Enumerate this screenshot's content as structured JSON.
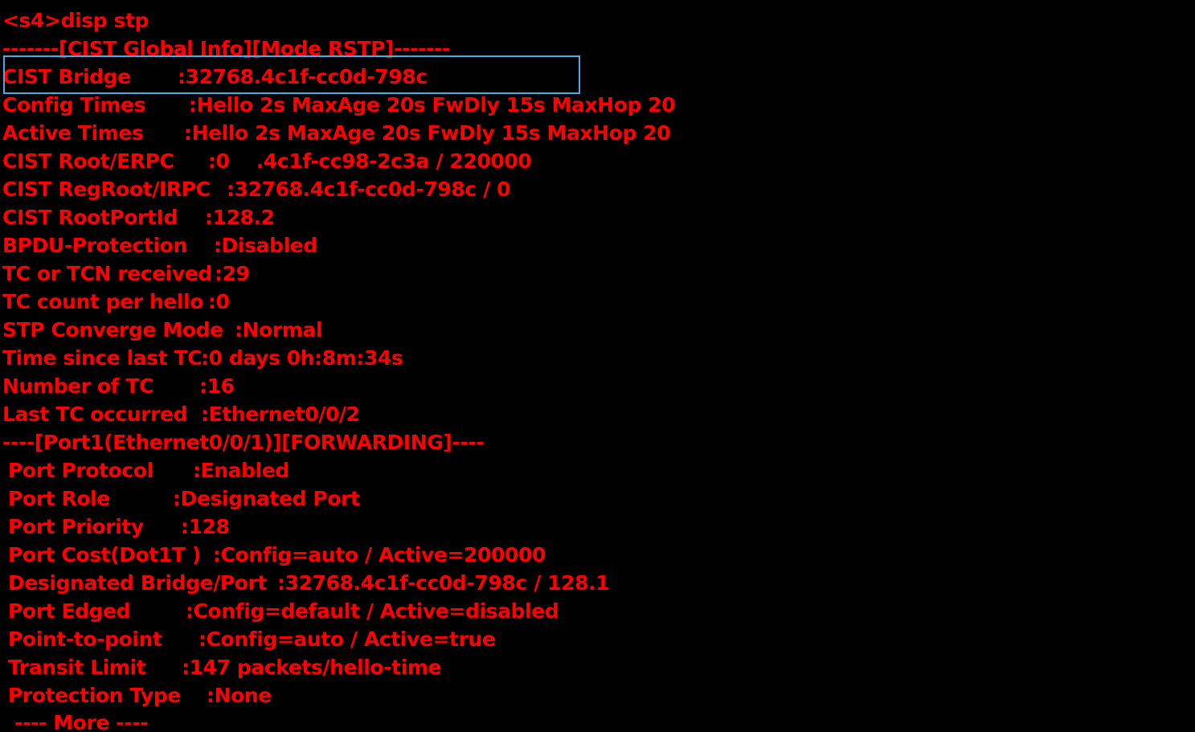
{
  "terminal": {
    "background": "#000000",
    "text_color": "#ff0000",
    "highlight_color": "#4fa8e6",
    "command_line": "<s4>disp stp",
    "global_header": "-------[CIST Global Info][Mode RSTP]-------",
    "global": [
      {
        "label": "CIST Bridge",
        "value": ":32768.4c1f-cc0d-798c"
      },
      {
        "label": "Config Times",
        "value": ":Hello 2s MaxAge 20s FwDly 15s MaxHop 20"
      },
      {
        "label": "Active Times",
        "value": ":Hello 2s MaxAge 20s FwDly 15s MaxHop 20"
      },
      {
        "label": "CIST Root/ERPC",
        "value": ":0    .4c1f-cc98-2c3a / 220000"
      },
      {
        "label": "CIST RegRoot/IRPC",
        "value": ":32768.4c1f-cc0d-798c / 0"
      },
      {
        "label": "CIST RootPortId",
        "value": ":128.2"
      },
      {
        "label": "BPDU-Protection",
        "value": ":Disabled"
      },
      {
        "label": "TC or TCN received",
        "value": ":29"
      },
      {
        "label": "TC count per hello",
        "value": ":0"
      },
      {
        "label": "STP Converge Mode",
        "value": ":Normal"
      },
      {
        "label": "Time since last TC",
        "value": ":0 days 0h:8m:34s"
      },
      {
        "label": "Number of TC",
        "value": ":16"
      },
      {
        "label": "Last TC occurred",
        "value": ":Ethernet0/0/2"
      }
    ],
    "port_header": "----[Port1(Ethernet0/0/1)][FORWARDING]----",
    "port": [
      {
        "label": "Port Protocol",
        "value": ":Enabled"
      },
      {
        "label": "Port Role",
        "value": ":Designated Port"
      },
      {
        "label": "Port Priority",
        "value": ":128"
      },
      {
        "label": "Port Cost(Dot1T )",
        "value": ":Config=auto / Active=200000"
      },
      {
        "label": "Designated Bridge/Port",
        "value": ":32768.4c1f-cc0d-798c / 128.1"
      },
      {
        "label": "Port Edged",
        "value": ":Config=default / Active=disabled"
      },
      {
        "label": "Point-to-point",
        "value": ":Config=auto / Active=true"
      },
      {
        "label": "Transit Limit",
        "value": ":147 packets/hello-time"
      },
      {
        "label": "Protection Type",
        "value": ":None"
      }
    ],
    "more_prompt": "---- More ----"
  }
}
